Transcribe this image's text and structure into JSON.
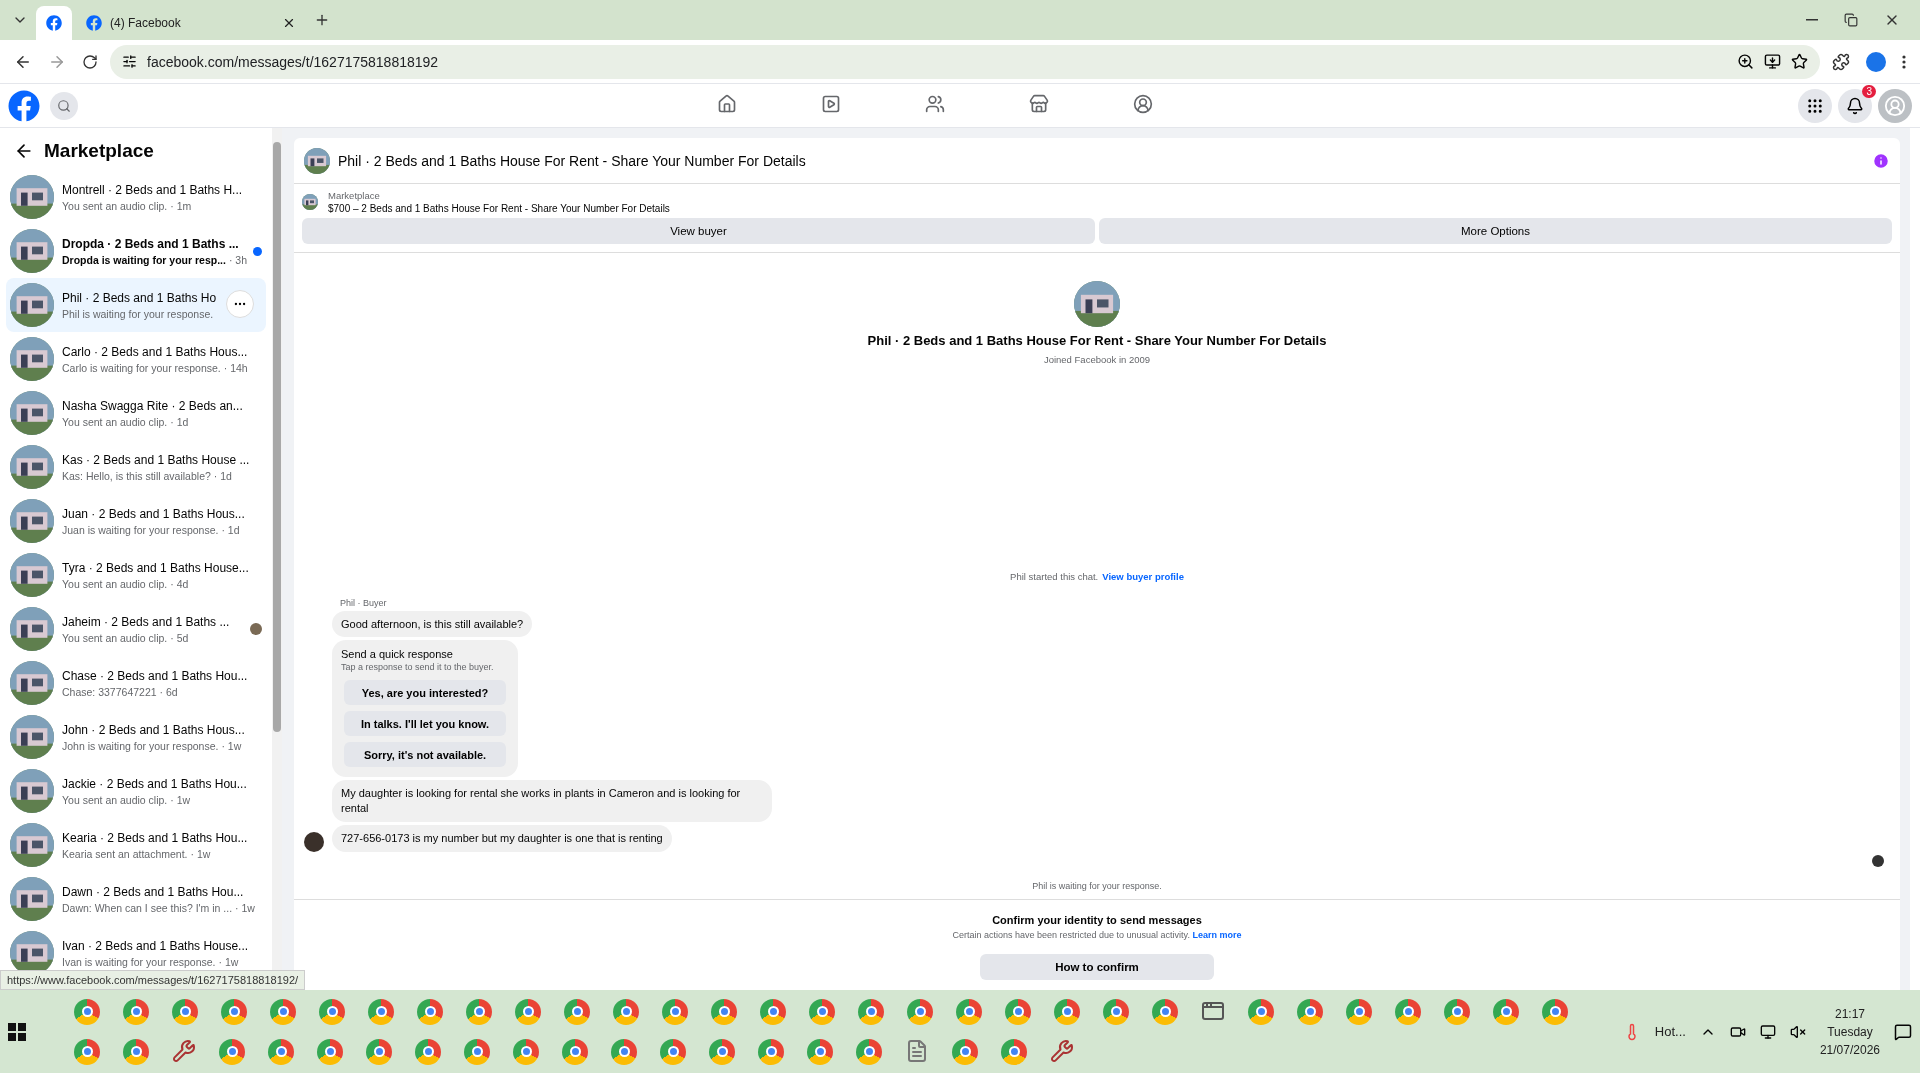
{
  "browser": {
    "pinned_tab": {
      "selected": true
    },
    "tabs": [
      {
        "title": "(4) Facebook",
        "selected": false
      }
    ],
    "url": "facebook.com/messages/t/1627175818818192"
  },
  "facebook_nav": {
    "items": [
      {
        "kind": "home",
        "selected": false
      },
      {
        "kind": "video",
        "selected": false
      },
      {
        "kind": "friends",
        "selected": false
      },
      {
        "kind": "marketplace",
        "selected": false
      },
      {
        "kind": "gaming",
        "selected": false
      }
    ],
    "notification_count": "3"
  },
  "sidebar": {
    "title": "Marketplace",
    "conversations": [
      {
        "name": "Montrell · 2 Beds and 1 Baths H...",
        "preview": "You sent an audio clip.",
        "time": "· 1m",
        "selected": false,
        "unread": false,
        "seen": false,
        "menu_shown": false
      },
      {
        "name": "Dropda · 2 Beds and 1 Baths ...",
        "preview": "Dropda is waiting for your resp...",
        "time": "· 3h",
        "selected": false,
        "unread": true,
        "seen": false,
        "menu_shown": false
      },
      {
        "name": "Phil · 2 Beds and 1 Baths Ho",
        "preview": "Phil is waiting for your response.",
        "selected": true,
        "unread": false,
        "seen": false,
        "menu_shown": true
      },
      {
        "name": "Carlo · 2 Beds and 1 Baths Hous...",
        "preview": "Carlo is waiting for your response.",
        "time": "· 14h",
        "selected": false,
        "unread": false,
        "seen": false,
        "menu_shown": false
      },
      {
        "name": "Nasha Swagga Rite · 2 Beds an...",
        "preview": "You sent an audio clip.",
        "time": "· 1d",
        "selected": false,
        "unread": false,
        "seen": false,
        "menu_shown": false
      },
      {
        "name": "Kas · 2 Beds and 1 Baths House ...",
        "preview": "Kas: Hello, is this still available?",
        "time": "· 1d",
        "selected": false,
        "unread": false,
        "seen": false,
        "menu_shown": false
      },
      {
        "name": "Juan · 2 Beds and 1 Baths Hous...",
        "preview": "Juan is waiting for your response.",
        "time": "· 1d",
        "selected": false,
        "unread": false,
        "seen": false,
        "menu_shown": false
      },
      {
        "name": "Tyra · 2 Beds and 1 Baths House...",
        "preview": "You sent an audio clip.",
        "time": "· 4d",
        "selected": false,
        "unread": false,
        "seen": false,
        "menu_shown": false
      },
      {
        "name": "Jaheim · 2 Beds and 1 Baths ...",
        "preview": "You sent an audio clip.",
        "time": "· 5d",
        "selected": false,
        "unread": false,
        "seen": true,
        "menu_shown": false
      },
      {
        "name": "Chase · 2 Beds and 1 Baths Hou...",
        "preview": "Chase: 3377647221",
        "time": "· 6d",
        "selected": false,
        "unread": false,
        "seen": false,
        "menu_shown": false
      },
      {
        "name": "John · 2 Beds and 1 Baths Hous...",
        "preview": "John is waiting for your response.",
        "time": "· 1w",
        "selected": false,
        "unread": false,
        "seen": false,
        "menu_shown": false
      },
      {
        "name": "Jackie · 2 Beds and 1 Baths Hou...",
        "preview": "You sent an audio clip.",
        "time": "· 1w",
        "selected": false,
        "unread": false,
        "seen": false,
        "menu_shown": false
      },
      {
        "name": "Kearia · 2 Beds and 1 Baths Hou...",
        "preview": "Kearia sent an attachment.",
        "time": "· 1w",
        "selected": false,
        "unread": false,
        "seen": false,
        "menu_shown": false
      },
      {
        "name": "Dawn · 2 Beds and 1 Baths Hou...",
        "preview": "Dawn: When can I see this? I'm in ...",
        "time": "· 1w",
        "selected": false,
        "unread": false,
        "seen": false,
        "menu_shown": false
      },
      {
        "name": "Ivan · 2 Beds and 1 Baths House...",
        "preview": "Ivan is waiting for your response.",
        "time": "· 1w",
        "selected": false,
        "unread": false,
        "seen": false,
        "menu_shown": false
      }
    ]
  },
  "chat": {
    "title": "Phil · 2 Beds and 1 Baths House For Rent - Share Your Number For Details",
    "listing": {
      "label": "Marketplace",
      "text": "$700 – 2 Beds and 1 Baths House For Rent - Share Your Number For Details"
    },
    "actions": [
      "View buyer",
      "More Options"
    ],
    "profile": {
      "name": "Phil · 2 Beds and 1 Baths House For Rent - Share Your Number For Details",
      "joined": "Joined Facebook in 2009"
    },
    "started_note": "Phil started this chat.",
    "started_link": "View buyer profile",
    "sender_label": "Phil · Buyer",
    "messages": [
      {
        "kind": "text",
        "text": "Good afternoon, is this still available?",
        "avatar": false
      },
      {
        "kind": "quick_responses",
        "title": "Send a quick response",
        "hint": "Tap a response to send it to the buyer.",
        "options": [
          "Yes, are you interested?",
          "In talks. I'll let you know.",
          "Sorry, it's not available."
        ],
        "avatar": false
      },
      {
        "kind": "text",
        "text": "My daughter is looking for rental she works in plants in Cameron and is looking for rental",
        "avatar": false
      },
      {
        "kind": "text",
        "text": "727-656-0173 is my number but my daughter is one that is renting",
        "avatar": true
      }
    ],
    "read_receipt": true,
    "waiting_note": "Phil is waiting for your response.",
    "notice": {
      "title": "Confirm your identity to send messages",
      "text": "Certain actions have been restricted due to unusual activity.",
      "link": "Learn more",
      "button": "How to confirm"
    }
  },
  "status_url": "https://www.facebook.com/messages/t/1627175818818192/",
  "taskbar": {
    "row_1": [
      {
        "kind": "browser"
      },
      {
        "kind": "browser"
      },
      {
        "kind": "browser"
      },
      {
        "kind": "browser"
      },
      {
        "kind": "browser"
      },
      {
        "kind": "browser"
      },
      {
        "kind": "browser"
      },
      {
        "kind": "browser"
      },
      {
        "kind": "browser"
      },
      {
        "kind": "browser"
      },
      {
        "kind": "browser"
      },
      {
        "kind": "browser"
      },
      {
        "kind": "browser"
      },
      {
        "kind": "browser"
      },
      {
        "kind": "browser"
      },
      {
        "kind": "browser"
      },
      {
        "kind": "browser"
      },
      {
        "kind": "browser"
      },
      {
        "kind": "browser"
      },
      {
        "kind": "browser"
      },
      {
        "kind": "browser"
      },
      {
        "kind": "browser"
      },
      {
        "kind": "browser"
      },
      {
        "kind": "app"
      },
      {
        "kind": "browser"
      },
      {
        "kind": "browser"
      },
      {
        "kind": "browser"
      },
      {
        "kind": "browser"
      },
      {
        "kind": "browser"
      },
      {
        "kind": "browser"
      },
      {
        "kind": "browser"
      }
    ],
    "row_2": [
      {
        "kind": "browser"
      },
      {
        "kind": "browser"
      },
      {
        "kind": "tool"
      },
      {
        "kind": "browser"
      },
      {
        "kind": "browser"
      },
      {
        "kind": "browser"
      },
      {
        "kind": "browser"
      },
      {
        "kind": "browser"
      },
      {
        "kind": "browser"
      },
      {
        "kind": "browser"
      },
      {
        "kind": "browser"
      },
      {
        "kind": "browser"
      },
      {
        "kind": "browser"
      },
      {
        "kind": "browser"
      },
      {
        "kind": "browser"
      },
      {
        "kind": "browser"
      },
      {
        "kind": "browser"
      },
      {
        "kind": "document"
      },
      {
        "kind": "browser"
      },
      {
        "kind": "browser"
      },
      {
        "kind": "tool"
      }
    ],
    "weather": "Hot...",
    "time": "21:17",
    "day": "Tuesday",
    "date": "21/07/2026"
  }
}
